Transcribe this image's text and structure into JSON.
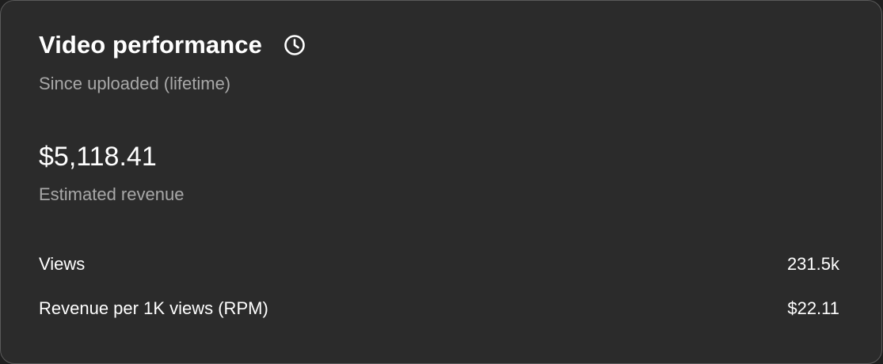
{
  "card": {
    "title": "Video performance",
    "subtitle": "Since uploaded (lifetime)",
    "clock_icon": "clock-icon"
  },
  "revenue": {
    "value": "$5,118.41",
    "label": "Estimated revenue"
  },
  "metrics": [
    {
      "label": "Views",
      "value": "231.5k"
    },
    {
      "label": "Revenue per 1K views (RPM)",
      "value": "$22.11"
    }
  ],
  "colors": {
    "card_background": "#2b2b2b",
    "primary_text": "#ffffff",
    "secondary_text": "#a8a8a8",
    "border": "#5a5a5a"
  }
}
